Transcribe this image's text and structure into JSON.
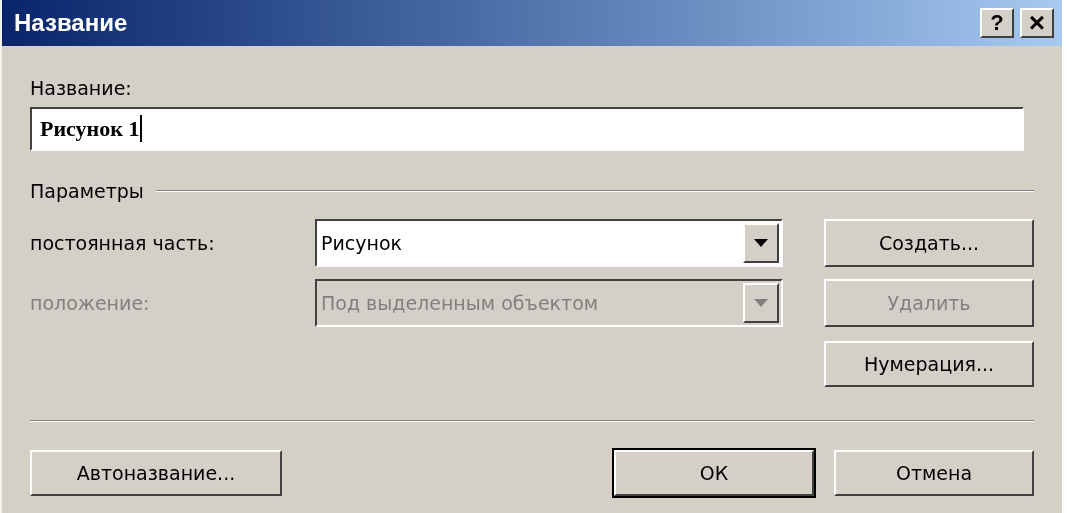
{
  "window": {
    "title": "Название",
    "buttons": [
      {
        "kind": "help",
        "label": "?"
      },
      {
        "kind": "close",
        "label": "×"
      }
    ]
  },
  "caption": {
    "label": "Название:",
    "value": "Рисунок 1"
  },
  "group": {
    "title": "Параметры"
  },
  "fields": [
    {
      "label": "постоянная часть:",
      "value": "Рисунок",
      "disabled": false,
      "button": "Создать...",
      "button_disabled": false
    },
    {
      "label": "положение:",
      "value": "Под выделенным объектом",
      "disabled": true,
      "button": "Удалить",
      "button_disabled": true
    }
  ],
  "numbering_button": "Нумерация...",
  "bottom_buttons": [
    {
      "label": "Автоназвание...",
      "default": false
    },
    {
      "label": "ОК",
      "default": true
    },
    {
      "label": "Отмена",
      "default": false
    }
  ]
}
